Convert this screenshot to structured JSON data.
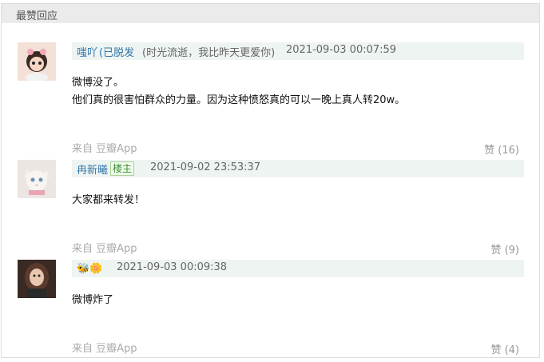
{
  "section_title": "最赞回应",
  "comments": [
    {
      "author": "嗤吖",
      "status": "(已脱发",
      "signature": "(时光流逝，我比昨天更爱你)",
      "time": "2021-09-03 00:07:59",
      "lines": [
        "微博没了。",
        "他们真的很害怕群众的力量。因为这种愤怒真的可以一晚上真人转20w。"
      ],
      "source": "来自 豆瓣App",
      "likes": "赞 (16)"
    },
    {
      "author": "冉新曦",
      "badge": "楼主",
      "time": "2021-09-02 23:53:37",
      "lines": [
        "大家都来转发！"
      ],
      "source": "来自 豆瓣App",
      "likes": "赞 (9)"
    },
    {
      "author_emoji": "🐝🌼",
      "time": "2021-09-03 00:09:38",
      "lines": [
        "微博炸了"
      ],
      "source": "来自 豆瓣App",
      "likes": "赞 (4)"
    }
  ],
  "colors": {
    "author": "#3377aa",
    "meta_bg": "#eef4f2",
    "header_bg": "#ebebeb",
    "muted": "#aaaaaa"
  }
}
